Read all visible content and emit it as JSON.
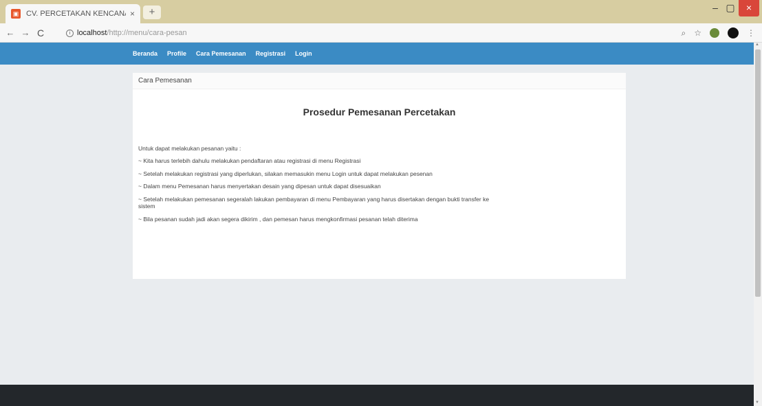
{
  "browser": {
    "tab_title": "CV. PERCETAKAN KENCANA",
    "tab_close": "×",
    "new_tab": "+",
    "window_controls": {
      "minimize": "–",
      "maximize": "▢",
      "close": "×"
    },
    "url_host": "localhost",
    "url_path": "/http://menu/cara-pesan",
    "nav": {
      "back": "←",
      "forward": "→",
      "refresh": "C"
    },
    "toolbar_icons": {
      "zoom": "⌕",
      "star": "☆",
      "menu": "⋮"
    }
  },
  "navbar": {
    "links": [
      "Beranda",
      "Profile",
      "Cara Pemesanan",
      "Registrasi",
      "Login"
    ]
  },
  "card": {
    "header": "Cara Pemesanan",
    "title": "Prosedur Pemesanan Percetakan",
    "intro": "Untuk dapat melakukan pesanan yaitu :",
    "steps": [
      "~ Kita harus terlebih dahulu melakukan pendaftaran atau registrasi di menu Registrasi",
      "~ Setelah melakukan registrasi yang diperlukan, silakan memasukin menu Login untuk dapat melakukan pesenan",
      "~ Dalam menu Pemesanan harus menyertakan desain yang dipesan untuk dapat disesuaikan",
      "~ Setelah melakukan pemesanan segeralah lakukan pembayaran di menu Pembayaran yang harus disertakan dengan bukti transfer ke sistem",
      "~ Bila pesanan sudah jadi akan segera dikirim , dan pemesan harus mengkonfirmasi pesanan telah diterima"
    ]
  }
}
